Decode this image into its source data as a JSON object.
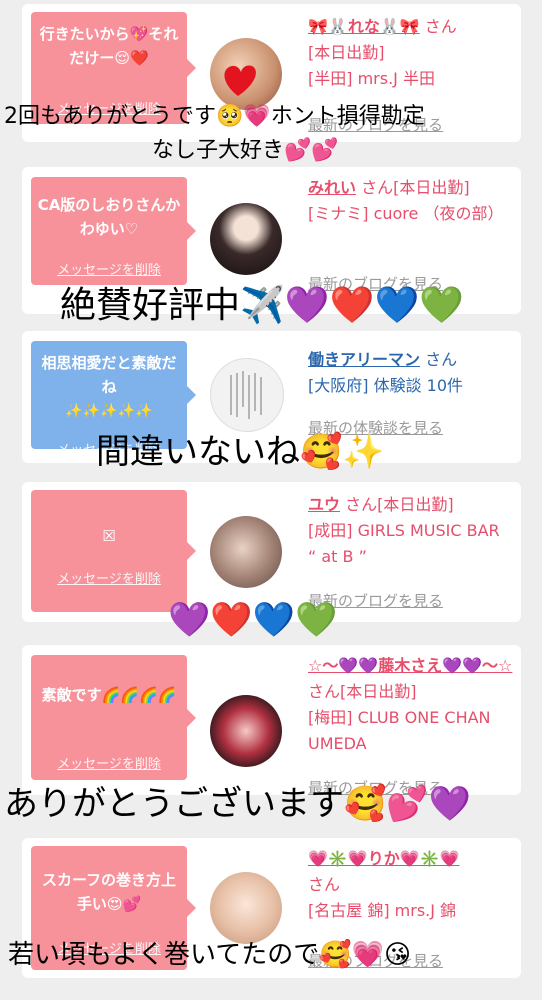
{
  "cards": [
    {
      "bubble_text": "行きたいから💖それだけー😌❤️",
      "delete_label": "メッセージを削除",
      "name": "🎀🐰れな🐰🎀",
      "san": "さん",
      "lines": [
        "[本日出勤]",
        "[半田] mrs.J 半田"
      ],
      "blog_label": "最新のブログを見る"
    },
    {
      "bubble_text": "CA版のしおりさんかわゆい♡",
      "delete_label": "メッセージを削除",
      "name": "みれい",
      "san": "さん[本日出勤]",
      "lines": [
        "[ミナミ] cuore （夜の部）"
      ],
      "blog_label": "最新のブログを見る"
    },
    {
      "bubble_text": "相思相愛だと素敵だね",
      "bubble_sparkles": "✨✨✨✨✨",
      "delete_label": "メッセージを削除",
      "name": "働きアリーマン",
      "san": "さん",
      "lines": [
        "[大阪府] 体験談 10件"
      ],
      "blog_label": "最新の体験談を見る"
    },
    {
      "bubble_text": "☒",
      "delete_label": "メッセージを削除",
      "name": "ユウ",
      "san": "さん[本日出勤]",
      "lines": [
        "[成田] GIRLS MUSIC BAR “ at B ”"
      ],
      "blog_label": "最新のブログを見る"
    },
    {
      "bubble_text": "素敵です🌈🌈🌈🌈",
      "delete_label": "メッセージを削除",
      "name": "☆〜💜💜藤木さえ💜💜〜☆",
      "san": "さん[本日出勤]",
      "lines": [
        "[梅田] CLUB ONE CHAN UMEDA"
      ],
      "blog_label": "最新のブログを見る"
    },
    {
      "bubble_text": "スカーフの巻き方上手い😍💕",
      "delete_label": "メッセージを削除",
      "name": "💗✳️💗りか💗✳️💗",
      "san": "さん",
      "lines": [
        "[名古屋 錦] mrs.J 錦"
      ],
      "blog_label": "最新のブログを見る"
    }
  ],
  "overlays": {
    "o1": "2回もありがとうです🥺💗ホント損得勘定",
    "o1b": "なし子大好き💕💕",
    "o2": "絶賛好評中✈️💜❤️💙💚",
    "o3": "間違いないね🥰✨",
    "o4": "💜❤️💙💚",
    "o5": "ありがとうございます🥰💕💜",
    "o6": "若い頃もよく巻いてたので🥰💗😘"
  },
  "colors": {
    "pink": "#f7929b",
    "blue": "#7fb2ea",
    "name_pink": "#e64e6b",
    "name_blue": "#2c67ad"
  }
}
